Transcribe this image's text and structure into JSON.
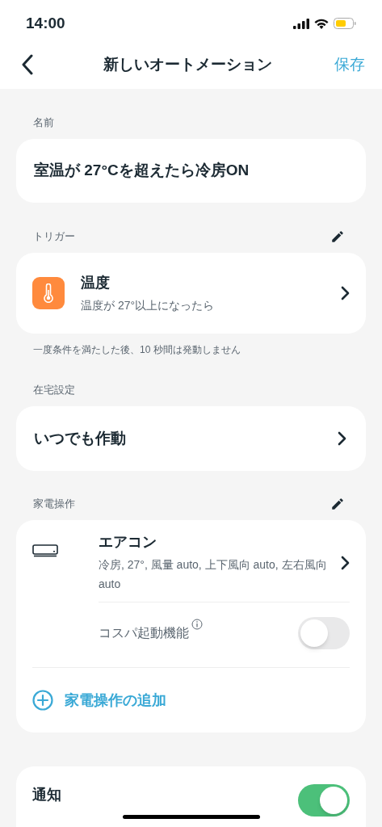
{
  "status_bar": {
    "time": "14:00"
  },
  "nav": {
    "title": "新しいオートメーション",
    "save": "保存"
  },
  "name_section": {
    "label": "名前",
    "value": "室温が 27°Cを超えたら冷房ON"
  },
  "trigger_section": {
    "label": "トリガー",
    "title": "温度",
    "subtitle": "温度が 27°以上になったら",
    "note": "一度条件を満たした後、10 秒間は発動しません"
  },
  "presence_section": {
    "label": "在宅設定",
    "value": "いつでも作動"
  },
  "appliance_section": {
    "label": "家電操作",
    "device": "エアコン",
    "settings": "冷房, 27°, 風量 auto, 上下風向 auto, 左右風向 auto",
    "cost_saving": {
      "label": "コスパ起動機能",
      "on": false
    },
    "add": "家電操作の追加"
  },
  "notification": {
    "label": "通知",
    "on": true
  }
}
